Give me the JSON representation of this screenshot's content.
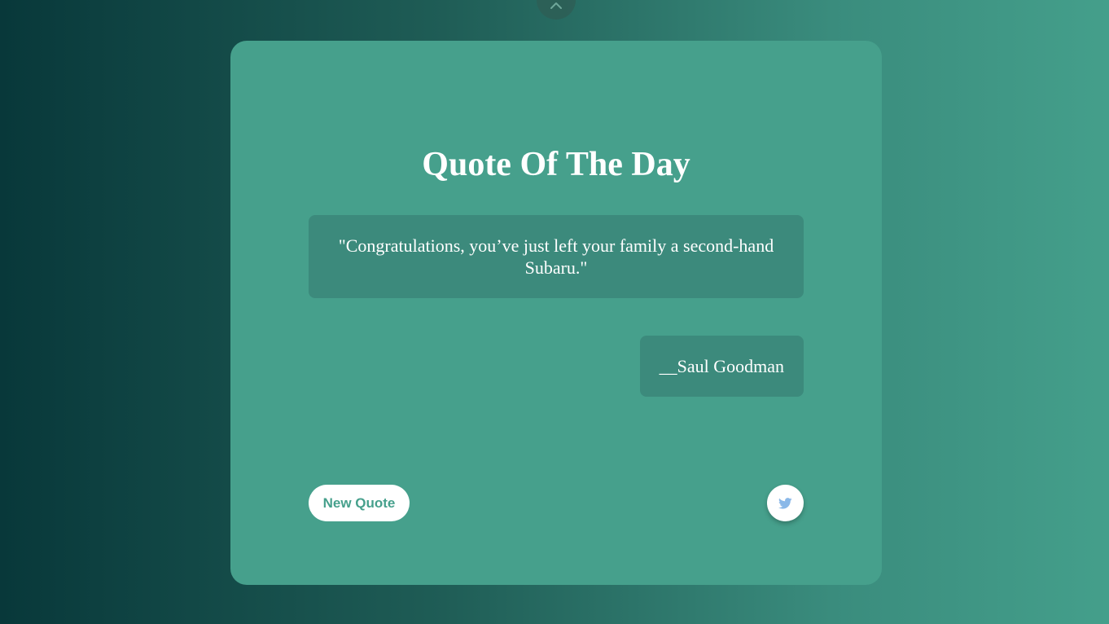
{
  "page": {
    "title": "Quote Of The Day",
    "background_gradient": [
      "#08383a",
      "#449f8b"
    ],
    "card_color": "#46a08c",
    "box_color": "#3c8a7c"
  },
  "quote": {
    "text": "\"Congratulations, you’ve just left your family a second-hand Subaru.\"",
    "author": "__Saul Goodman"
  },
  "actions": {
    "new_quote_label": "New Quote",
    "new_quote_text_color": "#46a08c",
    "tweet_icon": "twitter-icon",
    "tweet_icon_color": "#8ab8e8"
  },
  "toggle": {
    "icon": "chevron-up-icon"
  }
}
